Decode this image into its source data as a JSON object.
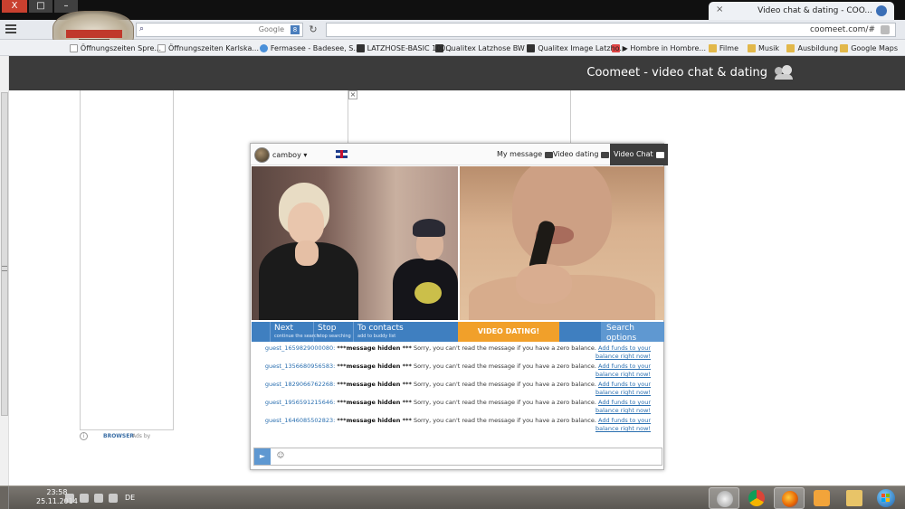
{
  "browser": {
    "tab_title": "Video chat & dating - COO...",
    "new_tab": "+",
    "window_buttons": {
      "close": "X",
      "maximize": "□",
      "minimize": "–"
    },
    "url": "coomeet.com/#",
    "search_placeholder": "Google",
    "search_badge": "8",
    "bookmarks": [
      {
        "label": "Google Maps",
        "icon": "folder"
      },
      {
        "label": "Ausbildung",
        "icon": "folder"
      },
      {
        "label": "Musik",
        "icon": "folder"
      },
      {
        "label": "Filme",
        "icon": "folder"
      },
      {
        "label": "▶ Hombre in Hombre...",
        "icon": "red"
      },
      {
        "label": "Qualitex Image Latzho...",
        "icon": "black"
      },
      {
        "label": "Qualitex Latzhose BW ...",
        "icon": "black"
      },
      {
        "label": "LATZHOSE-BASIC 100...",
        "icon": "black"
      },
      {
        "label": "Fermasee - Badesee, S...",
        "icon": "blue"
      },
      {
        "label": "Öffnungszeiten Karlska...",
        "icon": "doc"
      },
      {
        "label": "Öffnungszeiten Spre...",
        "icon": "doc"
      }
    ]
  },
  "page": {
    "title": "Coomeet - video chat & dating",
    "ad_brand": "BROWSER",
    "ad_note": "Ads by",
    "close_x": "×"
  },
  "widget": {
    "tabs": {
      "video_chat": "Video Chat",
      "video_dating": "Video dating",
      "my_message": "My message"
    },
    "username": "camboy ▾",
    "controls": {
      "search_options_big": "Search",
      "search_options_small": "options",
      "video_dating": "VIDEO DATING!",
      "to_contacts_big": "To contacts",
      "to_contacts_small": "add to buddy list",
      "stop_big": "Stop",
      "stop_small": "stop searching",
      "next_big": "Next",
      "next_small": "continue the search",
      "back": "◀◀"
    },
    "messages": [
      {
        "user": "guest_1659829000080:",
        "hidden": "***message hidden ***",
        "text": "Sorry, you can't read the message if you have a zero balance.",
        "link": "Add funds to your balance right now!"
      },
      {
        "user": "guest_1356680956583:",
        "hidden": "***message hidden ***",
        "text": "Sorry, you can't read the message if you have a zero balance.",
        "link": "Add funds to your balance right now!"
      },
      {
        "user": "guest_1829066762268:",
        "hidden": "***message hidden ***",
        "text": "Sorry, you can't read the message if you have a zero balance.",
        "link": "Add funds to your balance right now!"
      },
      {
        "user": "guest_1956591215646:",
        "hidden": "***message hidden ***",
        "text": "Sorry, you can't read the message if you have a zero balance.",
        "link": "Add funds to your balance right now!"
      },
      {
        "user": "guest_1646085502823:",
        "hidden": "***message hidden ***",
        "text": "Sorry, you can't read the message if you have a zero balance.",
        "link": "Add funds to your balance right now!"
      }
    ],
    "send": "►",
    "emoji": "☺"
  },
  "taskbar": {
    "time": "23:58",
    "date": "25.11.2014",
    "language": "DE"
  }
}
